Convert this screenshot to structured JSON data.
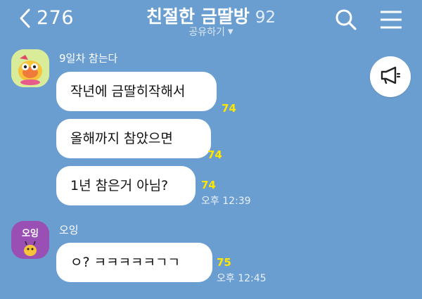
{
  "header": {
    "back_count": "276",
    "chat_name": "친절한 금딸방",
    "member_count": "92",
    "share_label": "공유하기"
  },
  "icons": {
    "back": "chevron-left-icon",
    "search": "search-icon",
    "menu": "hamburger-menu-icon",
    "notice": "megaphone-icon"
  },
  "colors": {
    "background": "#6b9ed0",
    "bubble": "#ffffff",
    "unread": "#ffe600"
  },
  "messages": [
    {
      "sender": "9일차 참는다",
      "items": [
        {
          "text": "작년에 금딸히작해서",
          "unread": "74"
        },
        {
          "text": "올해까지 참았으면",
          "unread": "74"
        },
        {
          "text": "1년 참은거 아님?",
          "unread": "74",
          "time": "오후 12:39"
        }
      ]
    },
    {
      "sender": "오잉",
      "avatar_text": "오잉",
      "items": [
        {
          "text": "ㅇ? ㅋㅋㅋㅋㅋㄱㄱ",
          "unread": "75",
          "time": "오후 12:45"
        }
      ]
    }
  ]
}
